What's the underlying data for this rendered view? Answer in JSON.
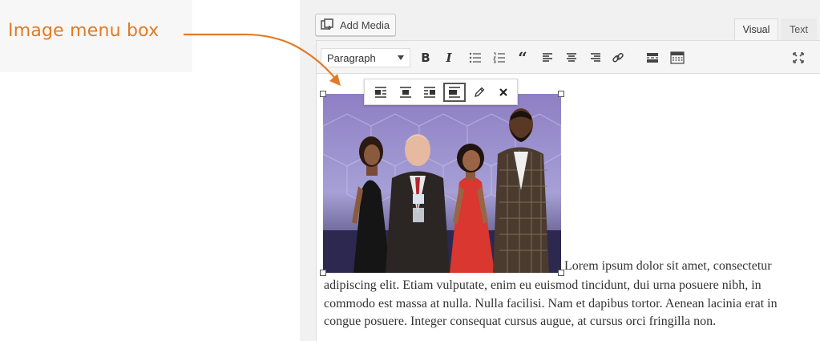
{
  "annotation": {
    "label": "Image menu box",
    "color": "#e07b26"
  },
  "editor": {
    "add_media_label": "Add Media",
    "tabs": {
      "visual": "Visual",
      "text": "Text"
    },
    "format_select": "Paragraph",
    "toolbar_icons": [
      "bold-icon",
      "italic-icon",
      "bulleted-list-icon",
      "numbered-list-icon",
      "blockquote-icon",
      "align-left-icon",
      "align-center-icon",
      "align-right-icon",
      "insert-link-icon",
      "read-more-icon",
      "toolbar-toggle-icon",
      "fullscreen-icon"
    ],
    "image_menu_icons": [
      "align-left-icon",
      "align-center-icon",
      "align-right-icon",
      "align-none-icon",
      "edit-pencil-icon",
      "remove-icon"
    ],
    "image_menu_active": "align-none-icon"
  },
  "content": {
    "first_line": "Lorem ipsum dolor sit amet, consectetur",
    "paragraph": "adipiscing elit. Etiam vulputate, enim eu euismod tincidunt, dui urna posuere nibh, in commodo est massa at nulla. Nulla facilisi. Nam et dapibus tortor. Aenean lacinia erat in congue posuere. Integer consequat cursus augue, at cursus orci fringilla non."
  }
}
